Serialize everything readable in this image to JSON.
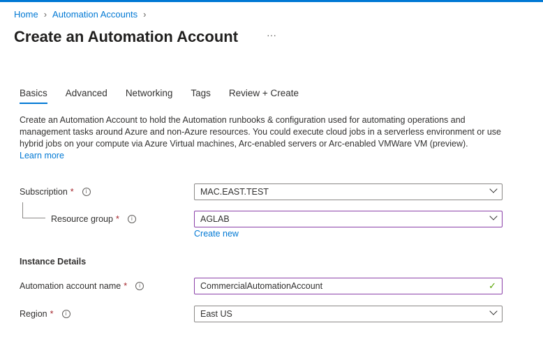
{
  "breadcrumb": [
    "Home",
    "Automation Accounts"
  ],
  "title": "Create an Automation Account",
  "more": "···",
  "tabs": [
    "Basics",
    "Advanced",
    "Networking",
    "Tags",
    "Review + Create"
  ],
  "description": "Create an Automation Account to hold the Automation runbooks & configuration used for automating operations and management tasks around Azure and non-Azure resources. You could execute cloud jobs in a serverless environment or use hybrid jobs on your compute via Azure Virtual machines, Arc-enabled servers or Arc-enabled VMWare VM (preview).",
  "learn_more": "Learn more",
  "form": {
    "subscription": {
      "label": "Subscription",
      "value": "MAC.EAST.TEST"
    },
    "resource_group": {
      "label": "Resource group",
      "value": "AGLAB",
      "create_new": "Create new"
    },
    "instance_details": "Instance Details",
    "account_name": {
      "label": "Automation account name",
      "value": "CommercialAutomationAccount"
    },
    "region": {
      "label": "Region",
      "value": "East US"
    },
    "required_mark": "*",
    "info_glyph": "i",
    "check_glyph": "✓"
  }
}
